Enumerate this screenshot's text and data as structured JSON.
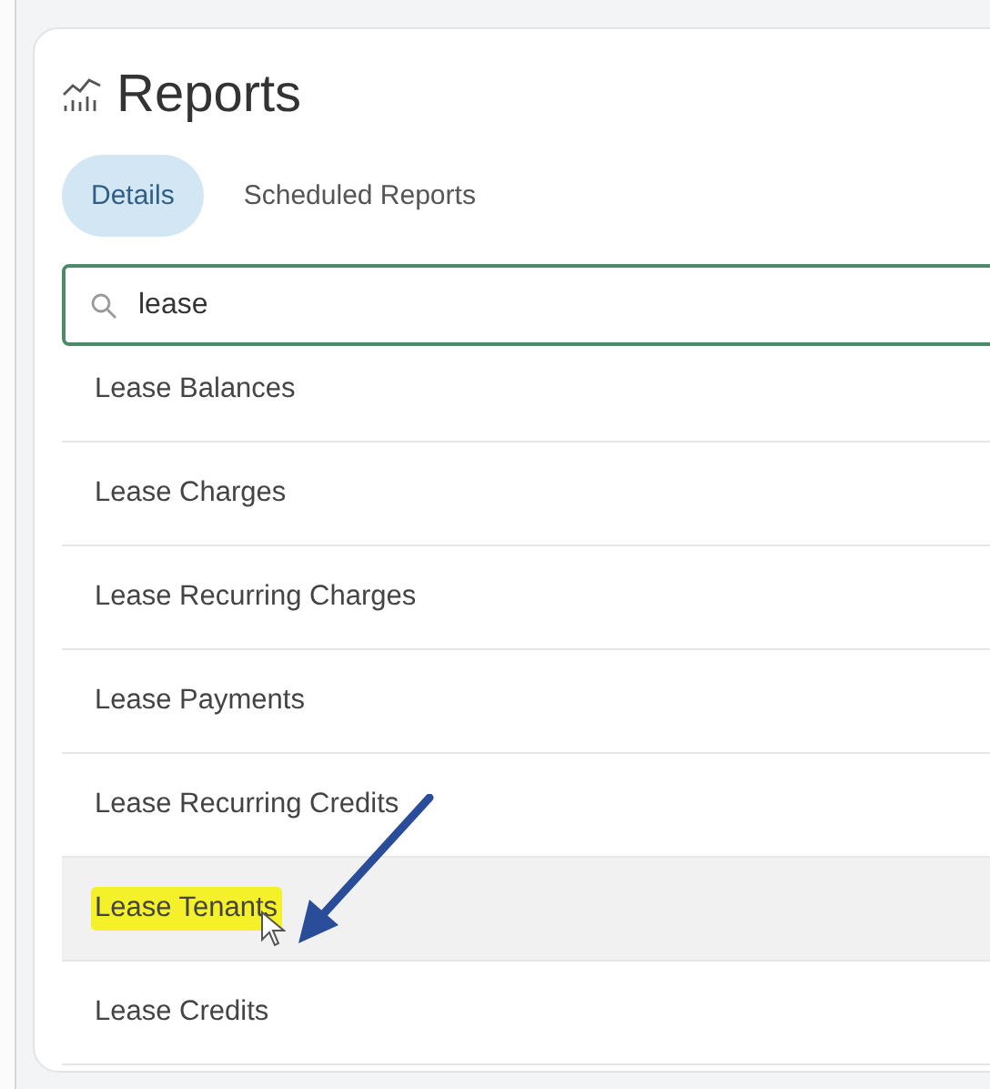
{
  "header": {
    "title": "Reports"
  },
  "tabs": [
    {
      "label": "Details",
      "selected": true
    },
    {
      "label": "Scheduled Reports",
      "selected": false
    }
  ],
  "search": {
    "value": "lease"
  },
  "reports": [
    {
      "name": "Lease Balances",
      "hovered": false,
      "highlighted": false
    },
    {
      "name": "Lease Charges",
      "hovered": false,
      "highlighted": false
    },
    {
      "name": "Lease Recurring Charges",
      "hovered": false,
      "highlighted": false
    },
    {
      "name": "Lease Payments",
      "hovered": false,
      "highlighted": false
    },
    {
      "name": "Lease Recurring Credits",
      "hovered": false,
      "highlighted": false
    },
    {
      "name": "Lease Tenants",
      "hovered": true,
      "highlighted": true
    },
    {
      "name": "Lease Credits",
      "hovered": false,
      "highlighted": false
    }
  ]
}
